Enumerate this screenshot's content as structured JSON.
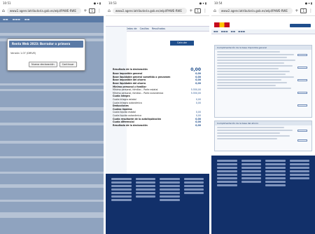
{
  "shots": [
    {
      "status_time": "10:51",
      "url": "www2.agenciatributaria.gob.es/wlpl/PAWE-RWE",
      "tab_count": "1",
      "modal": {
        "title": "Renta Web 2023: Borrador o primera",
        "text": "Versión 1.07 (DRIVE)",
        "btn_new": "Nueva declaración",
        "btn_cont": "Continuar"
      }
    },
    {
      "status_time": "10:53",
      "url": "www2.agenciatributaria.gob.es/wlpl/PAWE-RWE",
      "tab_count": "1",
      "ribbon": [
        "Apartados",
        "Datos de",
        "Casillas",
        "Resultados"
      ],
      "calc_label": "Calcular",
      "result_label": "Resultado de la declaración",
      "result_value": "0,00",
      "lines": [
        {
          "label": "Base imponible general",
          "value": "0,00",
          "bold": true
        },
        {
          "label": "Base liquidable general sometida a gravamen",
          "value": "0,00",
          "bold": true
        },
        {
          "label": "Base imponible del ahorro",
          "value": "0,00",
          "bold": true
        },
        {
          "label": "Base liquidable del ahorro",
          "value": "0,00",
          "bold": true
        },
        {
          "label": "Mínimo personal y familiar",
          "value": "",
          "bold": true
        },
        {
          "label": "Mínimo personal, familiar... Parte estatal",
          "value": "5.550,00",
          "bold": false
        },
        {
          "label": "Mínimo personal, familiar... Parte autonómica",
          "value": "5.550,00",
          "bold": false
        },
        {
          "label": "Cuota íntegra",
          "value": "",
          "bold": true
        },
        {
          "label": "Cuota íntegra estatal",
          "value": "0,00",
          "bold": false
        },
        {
          "label": "Cuota íntegra autonómica",
          "value": "0,00",
          "bold": false
        },
        {
          "label": "Deducciones",
          "value": "",
          "bold": true
        },
        {
          "label": "Cuotas líquidas",
          "value": "",
          "bold": true
        },
        {
          "label": "Cuota líquida estatal",
          "value": "0,00",
          "bold": false
        },
        {
          "label": "Cuota líquida autonómica",
          "value": "0,00",
          "bold": false
        },
        {
          "label": "Cuota resultante de la autoliquidación",
          "value": "0,00",
          "bold": true
        },
        {
          "label": "Cuota diferencial",
          "value": "0,00",
          "bold": true
        },
        {
          "label": "Resultado de la declaración",
          "value": "0,00",
          "bold": true
        }
      ]
    },
    {
      "status_time": "10:54",
      "url": "www2.agenciatributaria.gob.es/wlpl/PAWE-RWE",
      "tab_count": "1",
      "header": "Agencia Tributaria",
      "panels": [
        "Cumplimentación de la base imponible general",
        "Cumplimentación de la base del ahorro"
      ]
    }
  ],
  "colors": {
    "navy": "#12306a",
    "accent": "#1f4e8c",
    "overlay": "#8fa3bf"
  }
}
